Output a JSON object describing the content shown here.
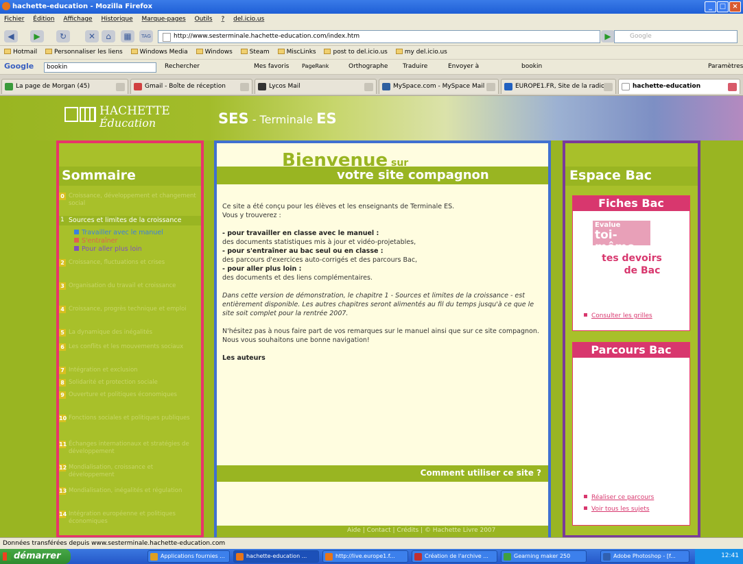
{
  "window": {
    "title": "hachette-education - Mozilla Firefox",
    "buttons": [
      "_",
      "□",
      "×"
    ]
  },
  "menu": [
    "Fichier",
    "Édition",
    "Affichage",
    "Historique",
    "Marque-pages",
    "Outils",
    "?",
    "del.icio.us"
  ],
  "nav": {
    "url": "http://www.sesterminale.hachette-education.com/index.htm",
    "search_placeholder": "Google",
    "tag_label": "TAG"
  },
  "bookmarks": [
    "Hotmail",
    "Personnaliser les liens",
    "Windows Media",
    "Windows",
    "Steam",
    "MiscLinks",
    "post to del.icio.us",
    "my del.icio.us"
  ],
  "googlebar": {
    "logo": "Google",
    "query": "bookin",
    "rechercher": "Rechercher",
    "favoris": "Mes favoris",
    "pagerank": "PageRank",
    "orthographe": "Orthographe",
    "traduire": "Traduire",
    "envoyer": "Envoyer à",
    "bookin": "bookin",
    "parametres": "Paramètres"
  },
  "tabs": [
    {
      "label": "La page de Morgan (45)",
      "color": "#3a9a3a"
    },
    {
      "label": "Gmail - Boîte de réception",
      "color": "#d04040"
    },
    {
      "label": "Lycos Mail",
      "color": "#333333"
    },
    {
      "label": "MySpace.com - MySpace Mail",
      "color": "#3060a0"
    },
    {
      "label": "EUROPE1.FR, Site de la radio...",
      "color": "#2060c0"
    },
    {
      "label": "hachette-education",
      "color": "#ffffff"
    }
  ],
  "site": {
    "logo_line1": "HACHETTE",
    "logo_line2": "Éducation",
    "ses": "SES",
    "terminale": " - Terminale ",
    "es": "ES",
    "sommaire": "Sommaire",
    "toc": [
      {
        "n": "0",
        "t": "Croissance, développement et changement social"
      },
      {
        "n": "1",
        "t": "Sources et limites de la croissance"
      },
      {
        "n": "2",
        "t": "Croissance, fluctuations et crises"
      },
      {
        "n": "3",
        "t": "Organisation du travail et croissance"
      },
      {
        "n": "4",
        "t": "Croissance, progrès technique et emploi"
      },
      {
        "n": "5",
        "t": "La dynamique des inégalités"
      },
      {
        "n": "6",
        "t": "Les conflits et les mouvements sociaux"
      },
      {
        "n": "7",
        "t": "Intégration et exclusion"
      },
      {
        "n": "8",
        "t": "Solidarité et protection sociale"
      },
      {
        "n": "9",
        "t": "Ouverture et politiques économiques"
      },
      {
        "n": "10",
        "t": "Fonctions sociales et politiques publiques"
      },
      {
        "n": "11",
        "t": "Échanges internationaux et stratégies de développement"
      },
      {
        "n": "12",
        "t": "Mondialisation, croissance et développement"
      },
      {
        "n": "13",
        "t": "Mondialisation, inégalités et régulation"
      },
      {
        "n": "14",
        "t": "Intégration européenne et politiques économiques"
      }
    ],
    "toc_active": "Sources et limites de la croissance",
    "toc_sub": [
      {
        "t": "Travailler avec le manuel",
        "color": "#3a80e0"
      },
      {
        "t": "S'entraîner",
        "color": "#e06050"
      },
      {
        "t": "Pour aller plus loin",
        "color": "#8050c0"
      }
    ],
    "bienvenue": "Bienvenue",
    "sur": " sur",
    "compagnon": "votre site compagnon",
    "intro1": "Ce site a été conçu pour les élèves et les enseignants de Terminale ES.",
    "intro2": "Vous y trouverez :",
    "b1": "- pour travailler en classe avec le manuel :",
    "d1": "des documents statistiques mis à jour et vidéo-projetables,",
    "b2": "- pour s'entraîner au bac seul ou en classe :",
    "d2": "des parcours d'exercices auto-corrigés et des parcours Bac,",
    "b3": "- pour aller plus loin :",
    "d3": "des documents et des liens complémentaires.",
    "demo": "Dans cette version de démonstration, le chapitre 1 - Sources et limites de la croissance - est entièrement disponible. Les autres chapitres seront alimentés au fil du temps jusqu'à ce que le site soit complet pour la rentrée 2007.",
    "hesitez": "N'hésitez pas à nous faire part de vos remarques sur le manuel ainsi que sur ce site compagnon.",
    "bonne": "Nous vous souhaitons une bonne navigation!",
    "auteurs": "Les auteurs",
    "comment": "Comment utiliser ce site ?",
    "footer": "Aide   |   Contact   |   Crédits   |   © Hachette Livre 2007",
    "espace": "Espace Bac",
    "fiches": "Fiches Bac",
    "evalue": "Evalue",
    "toimeme": "toi-même",
    "devoirs1": "tes devoirs",
    "devoirs2": "de Bac",
    "consulter": "Consulter les grilles",
    "parcours": "Parcours Bac",
    "realiser": "Réaliser ce parcours",
    "voir": "Voir tous les sujets"
  },
  "status": "Données transférées depuis www.sesterminale.hachette-education.com",
  "taskbar": {
    "start": "démarrer",
    "items": [
      {
        "label": "Applications fournies ...",
        "color": "#e0a020"
      },
      {
        "label": "hachette-education ...",
        "color": "#e8751a"
      },
      {
        "label": "http://live.europe1.f...",
        "color": "#e8751a"
      },
      {
        "label": "Création de l'archive ...",
        "color": "#c03030"
      },
      {
        "label": "Gearning maker 250",
        "color": "#40a040"
      },
      {
        "label": "Adobe Photoshop - [f...",
        "color": "#3060b0"
      }
    ],
    "clock": "12:41"
  }
}
